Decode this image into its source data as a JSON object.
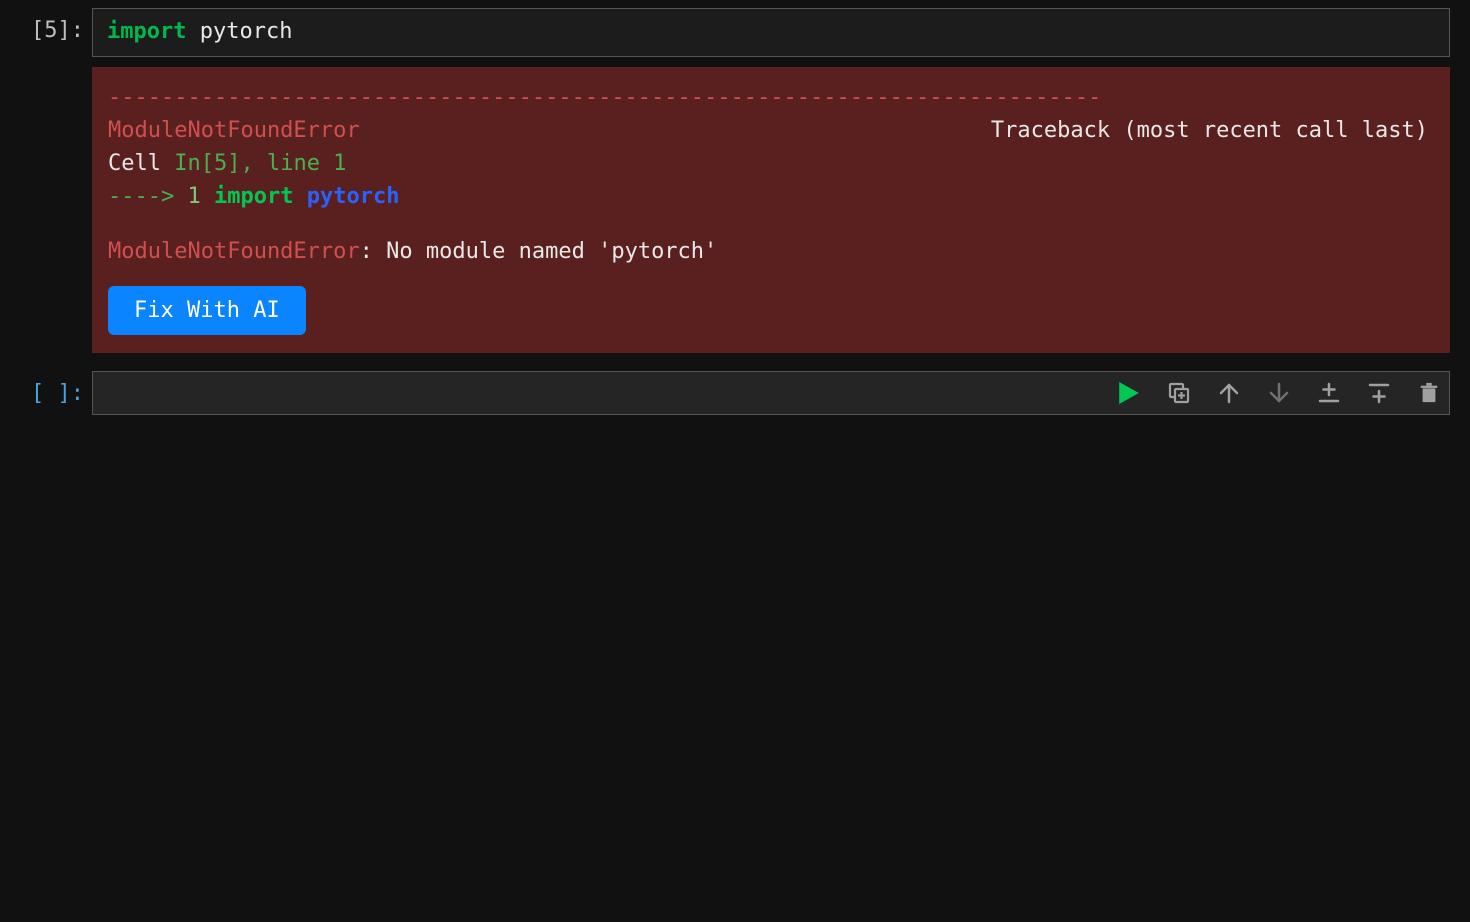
{
  "cell1": {
    "prompt": "[5]:",
    "code": {
      "import_kw": "import",
      "module": "pytorch"
    }
  },
  "error": {
    "dashes": "---------------------------------------------------------------------------",
    "err_type": "ModuleNotFoundError",
    "traceback_label": "Traceback (most recent call last)",
    "cell_label": "Cell ",
    "in_ref": "In[5]",
    "line_ref": ", line 1",
    "arrow": "----> ",
    "lineno": "1",
    "import_kw": "import",
    "module": "pytorch",
    "err_type2": "ModuleNotFoundError",
    "message": ": No module named 'pytorch'",
    "fix_label": "Fix With AI"
  },
  "cell2": {
    "prompt": "[ ]:"
  },
  "toolbar": {
    "run": "run",
    "duplicate": "duplicate",
    "up": "move up",
    "down": "move down",
    "insert_above": "insert above",
    "insert_below": "insert below",
    "delete": "delete"
  },
  "colors": {
    "run_icon": "#00c853",
    "icon_default": "#a0a0a0"
  }
}
